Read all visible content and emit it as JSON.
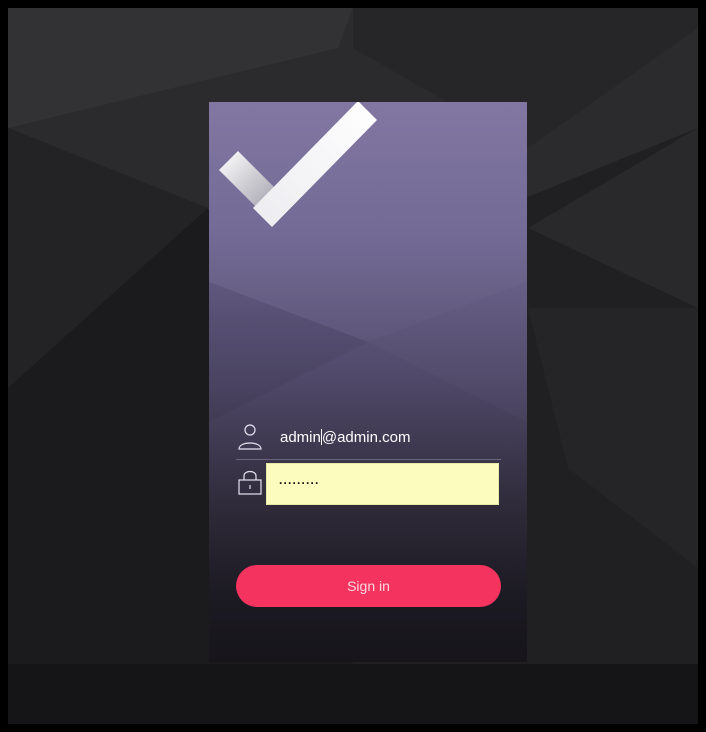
{
  "login": {
    "email_value_before_caret": "admin",
    "email_value_after_caret": "@admin.com",
    "password_masked": "·········",
    "signin_label": "Sign in"
  },
  "icons": {
    "logo": "checkmark-icon",
    "user": "user-icon",
    "password": "lock-icon"
  },
  "colors": {
    "card_top": "#7c729f",
    "card_bottom": "#17151b",
    "button": "#f4345f",
    "password_autofill_bg": "#fbfcbd",
    "background": "#1e1e20"
  }
}
